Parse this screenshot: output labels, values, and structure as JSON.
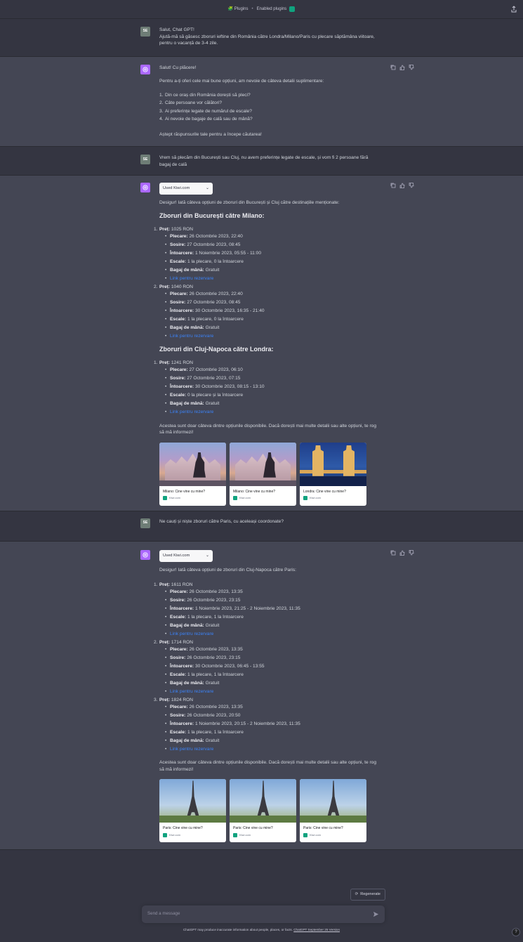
{
  "topbar": {
    "plugins_label": "🧩 Plugins",
    "dot": "•",
    "enabled_plugins_label": "Enabled plugins"
  },
  "messages": {
    "user1": {
      "avatar": "SE",
      "line1": "Salut, Chat GPT!",
      "line2": "Ajută-mă să găsesc zboruri ieftine din România către Londra/Milano/Paris cu plecare săptămâna viitoare, pentru o vacanță de 3-4 zile."
    },
    "asst1": {
      "greeting": "Salut! Cu plăcere!",
      "intro": "Pentru a-ți oferi cele mai bune opțiuni, am nevoie de câteva detalii suplimentare:",
      "questions": [
        {
          "n": "1.",
          "text": "Din ce oraș din România dorești să pleci?"
        },
        {
          "n": "2.",
          "text": "Câte persoane vor călători?"
        },
        {
          "n": "3.",
          "text": "Ai preferințe legate de numărul de escale?"
        },
        {
          "n": "4.",
          "text": "Ai nevoie de bagaje de cală sau de mână?"
        }
      ],
      "closing": "Aștept răspunsurile tale pentru a începe căutarea!"
    },
    "user2": {
      "avatar": "SE",
      "text": "Vrem să plecăm din București sau Cluj, nu avem preferințe legate de escale, și vom fi 2 persoane fără bagaj de cală"
    },
    "asst2": {
      "plugin_label": "Used Kiwi.com",
      "intro": "Desigur! Iată câteva opțiuni de zboruri din București și Cluj către destinațiile menționate:",
      "section1_title": "Zboruri din București către Milano:",
      "section2_title": "Zboruri din Cluj-Napoca către Londra:",
      "outro": "Acestea sunt doar câteva dintre opțiunile disponibile. Dacă dorești mai multe detalii sau alte opțiuni, te rog să mă informezi!",
      "cards": [
        {
          "caption": "Milano: Cine vine cu mine?",
          "source": "Kiwi.com"
        },
        {
          "caption": "Milano: Cine vine cu mine?",
          "source": "Kiwi.com"
        },
        {
          "caption": "Londra: Cine vine cu mine?",
          "source": "Kiwi.com"
        }
      ]
    },
    "user3": {
      "avatar": "SE",
      "text": "Ne cauți și niște zboruri către Paris, cu aceleași coordonate?"
    },
    "asst3": {
      "plugin_label": "Used Kiwi.com",
      "intro": "Desigur! Iată câteva opțiuni de zboruri din Cluj-Napoca către Paris:",
      "outro": "Acestea sunt doar câteva dintre opțiunile disponibile. Dacă dorești mai multe detalii sau alte opțiuni, te rog să mă informezi!",
      "cards": [
        {
          "caption": "Paris: Cine vine cu mine?",
          "source": "Kiwi.com"
        },
        {
          "caption": "Paris: Cine vine cu mine?",
          "source": "Kiwi.com"
        },
        {
          "caption": "Paris: Cine vine cu mine?",
          "source": "Kiwi.com"
        }
      ]
    }
  },
  "labels": {
    "price": "Preț:",
    "depart": "Plecare:",
    "arrive": "Sosire:",
    "return": "Întoarcere:",
    "stops": "Escale:",
    "bag": "Bagaj de mână:"
  },
  "flights": {
    "milano": [
      {
        "n": "1.",
        "price": "1025 RON",
        "depart": "26 Octombrie 2023, 22:40",
        "arrive": "27 Octombrie 2023, 08:45",
        "return": "1 Noiembrie 2023, 05:55 - 11:00",
        "stops": "1 la plecare, 0 la întoarcere",
        "bag": "Gratuit",
        "link": "Link pentru rezervare"
      },
      {
        "n": "2.",
        "price": "1040 RON",
        "depart": "26 Octombrie 2023, 22:40",
        "arrive": "27 Octombrie 2023, 08:45",
        "return": "30 Octombrie 2023, 16:35 - 21:40",
        "stops": "1 la plecare, 0 la întoarcere",
        "bag": "Gratuit",
        "link": "Link pentru rezervare"
      }
    ],
    "londra": [
      {
        "n": "1.",
        "price": "1241 RON",
        "depart": "27 Octombrie 2023, 06:10",
        "arrive": "27 Octombrie 2023, 07:15",
        "return": "30 Octombrie 2023, 08:15 - 13:10",
        "stops": "0 la plecare și la întoarcere",
        "bag": "Gratuit",
        "link": "Link pentru rezervare"
      }
    ],
    "paris": [
      {
        "n": "1.",
        "price": "1611 RON",
        "depart": "26 Octombrie 2023, 13:35",
        "arrive": "26 Octombrie 2023, 23:15",
        "return": "1 Noiembrie 2023, 21:25 - 2 Noiembrie 2023, 11:35",
        "stops": "1 la plecare, 1 la întoarcere",
        "bag": "Gratuit",
        "link": "Link pentru rezervare"
      },
      {
        "n": "2.",
        "price": "1714 RON",
        "depart": "26 Octombrie 2023, 13:35",
        "arrive": "26 Octombrie 2023, 23:15",
        "return": "30 Octombrie 2023, 06:45 - 13:55",
        "stops": "1 la plecare, 1 la întoarcere",
        "bag": "Gratuit",
        "link": "Link pentru rezervare"
      },
      {
        "n": "3.",
        "price": "1824 RON",
        "depart": "26 Octombrie 2023, 13:35",
        "arrive": "26 Octombrie 2023, 20:50",
        "return": "1 Noiembrie 2023, 20:15 - 2 Noiembrie 2023, 11:35",
        "stops": "1 la plecare, 1 la întoarcere",
        "bag": "Gratuit",
        "link": "Link pentru rezervare"
      }
    ]
  },
  "composer": {
    "regenerate_label": "Regenerate",
    "placeholder": "Send a message",
    "disclaimer": "ChatGPT may produce inaccurate information about people, places, or facts.",
    "version_link": "ChatGPT September 25 Version",
    "help": "?"
  }
}
